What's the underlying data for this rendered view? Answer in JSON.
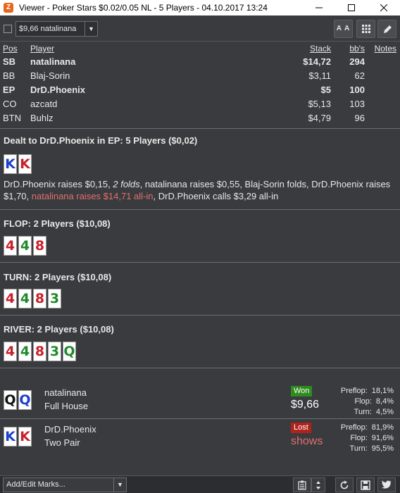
{
  "window": {
    "title": "Viewer - Poker Stars $0.02/0.05 NL - 5 Players - 04.10.2017 13:24",
    "app_icon": "Z"
  },
  "toolbar": {
    "hand_select_value": "$9,66 natalinana",
    "font_button_label": "A A"
  },
  "players_table": {
    "headers": {
      "pos": "Pos",
      "player": "Player",
      "stack": "Stack",
      "bbs": "bb's",
      "notes": "Notes"
    },
    "rows": [
      {
        "pos": "SB",
        "name": "natalinana",
        "stack": "$14,72",
        "bbs": "294"
      },
      {
        "pos": "BB",
        "name": "Blaj-Sorin",
        "stack": "$3,11",
        "bbs": "62"
      },
      {
        "pos": "EP",
        "name": "DrD.Phoenix",
        "stack": "$5",
        "bbs": "100"
      },
      {
        "pos": "CO",
        "name": "azcatd",
        "stack": "$5,13",
        "bbs": "103"
      },
      {
        "pos": "BTN",
        "name": "Buhlz",
        "stack": "$4,79",
        "bbs": "96"
      }
    ]
  },
  "preflop": {
    "title": "Dealt to DrD.Phoenix in EP: 5 Players ($0,02)",
    "cards": [
      "K",
      "K"
    ],
    "actions": {
      "part1": "DrD.Phoenix raises $0,15, ",
      "part2": "2 folds",
      "part3": ", natalinana raises $0,55, Blaj-Sorin folds, DrD.Phoenix raises $1,70, ",
      "part4": "natalinana raises $14,71 all-in",
      "part5": ", DrD.Phoenix calls $3,29 all-in"
    }
  },
  "flop": {
    "title": "FLOP: 2 Players ($10,08)",
    "cards": [
      "4",
      "4",
      "8"
    ]
  },
  "turn": {
    "title": "TURN: 2 Players ($10,08)",
    "cards": [
      "4",
      "4",
      "8",
      "3"
    ]
  },
  "river": {
    "title": "RIVER: 2 Players ($10,08)",
    "cards": [
      "4",
      "4",
      "8",
      "3",
      "Q"
    ]
  },
  "showdown": [
    {
      "name": "natalinana",
      "hand": "Full House",
      "cards": [
        "Q",
        "Q"
      ],
      "result": "Won",
      "amount": "$9,66",
      "stats": [
        {
          "k": "Preflop:",
          "v": "18,1%"
        },
        {
          "k": "Flop:",
          "v": "8,4%"
        },
        {
          "k": "Turn:",
          "v": "4,5%"
        }
      ]
    },
    {
      "name": "DrD.Phoenix",
      "hand": "Two Pair",
      "cards": [
        "K",
        "K"
      ],
      "result": "Lost",
      "amount": "shows",
      "stats": [
        {
          "k": "Preflop:",
          "v": "81,9%"
        },
        {
          "k": "Flop:",
          "v": "91,6%"
        },
        {
          "k": "Turn:",
          "v": "95,5%"
        }
      ]
    }
  ],
  "bottom": {
    "marks_label": "Add/Edit Marks..."
  },
  "colors": {
    "hearts": "#c8202a",
    "diamonds": "#1d3fc9",
    "clubs": "#1e8a2b",
    "spades": "#111111",
    "won": "#2f8b1d",
    "lost": "#b0231b",
    "allin_text": "#e07070"
  }
}
